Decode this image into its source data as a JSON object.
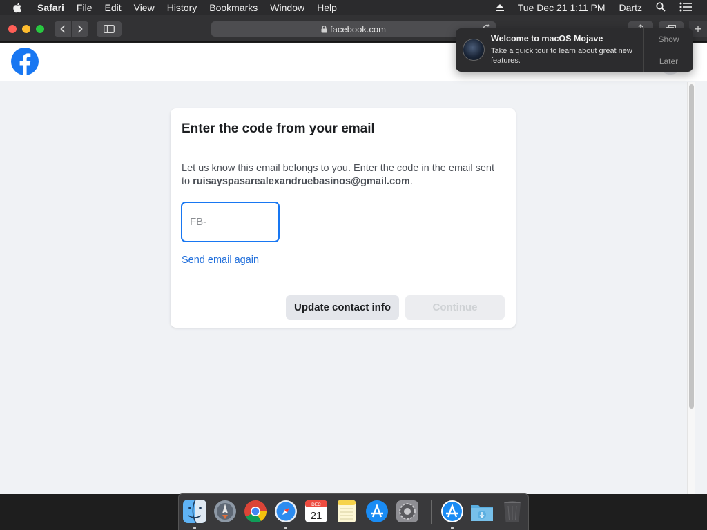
{
  "menubar": {
    "app": "Safari",
    "items": [
      "File",
      "Edit",
      "View",
      "History",
      "Bookmarks",
      "Window",
      "Help"
    ],
    "datetime": "Tue Dec 21  1:11 PM",
    "user": "Dartz"
  },
  "browser": {
    "url": "facebook.com"
  },
  "notification": {
    "title": "Welcome to macOS Mojave",
    "body": "Take a quick tour to learn about great new features.",
    "show": "Show",
    "later": "Later"
  },
  "card": {
    "title": "Enter the code from your email",
    "desc_prefix": "Let us know this email belongs to you. Enter the code in the email sent to ",
    "email": "ruisayspasarealexandruebasinos@gmail.com",
    "desc_suffix": ".",
    "code_placeholder": "FB-",
    "code_value": "",
    "resend": "Send email again",
    "update_button": "Update contact info",
    "continue_button": "Continue"
  },
  "calendar_icon": {
    "month": "DEC",
    "day": "21"
  },
  "colors": {
    "facebook_blue": "#1877f2",
    "link_blue": "#216fdb",
    "page_bg": "#f0f2f5"
  },
  "dock": {
    "items": [
      "finder-icon",
      "launchpad-icon",
      "chrome-icon",
      "safari-icon",
      "calendar-icon",
      "notes-icon",
      "app-store-icon",
      "system-preferences-icon",
      "app-store-download-icon",
      "downloads-folder-icon",
      "trash-icon"
    ]
  }
}
